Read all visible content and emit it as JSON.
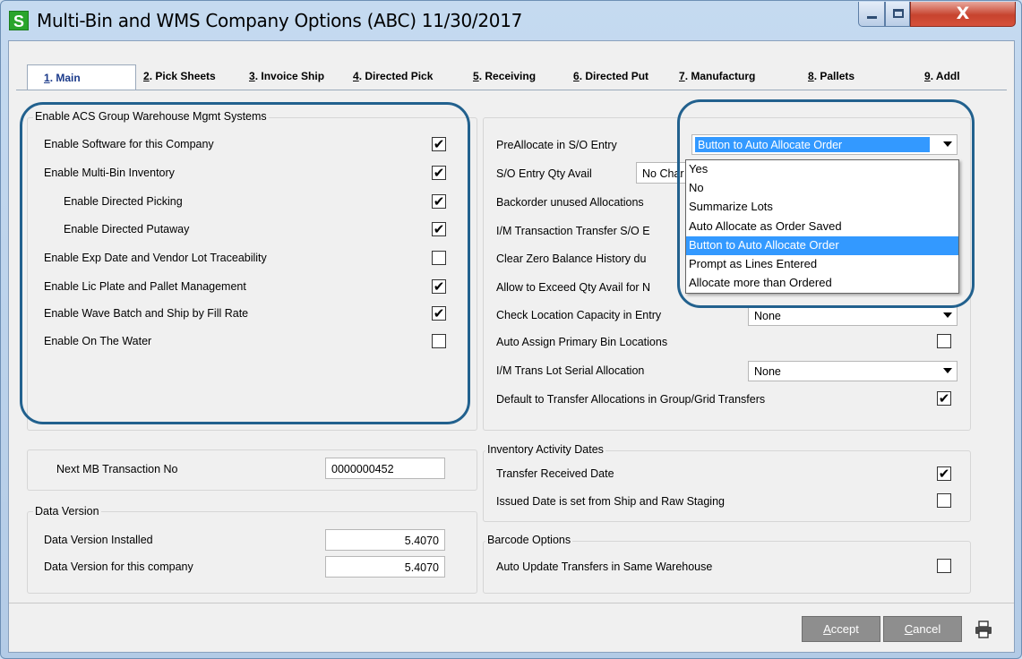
{
  "window": {
    "app_icon_letter": "S",
    "title": "Multi-Bin and WMS Company Options (ABC) 11/30/2017",
    "close_glyph": "X"
  },
  "tabs": [
    {
      "num": "1",
      "label": ". Main"
    },
    {
      "num": "2",
      "label": ". Pick Sheets"
    },
    {
      "num": "3",
      "label": ". Invoice Ship"
    },
    {
      "num": "4",
      "label": ". Directed Pick"
    },
    {
      "num": "5",
      "label": ". Receiving"
    },
    {
      "num": "6",
      "label": ". Directed Put"
    },
    {
      "num": "7",
      "label": ". Manufacturg"
    },
    {
      "num": "8",
      "label": ". Pallets"
    },
    {
      "num": "9",
      "label": ". Addl"
    }
  ],
  "wms_group": {
    "title": "Enable ACS Group Warehouse Mgmt Systems",
    "items": [
      {
        "label": "Enable Software for this Company",
        "checked": true
      },
      {
        "label": "Enable Multi-Bin Inventory",
        "checked": true
      },
      {
        "label": "Enable Directed Picking",
        "checked": true
      },
      {
        "label": "Enable Directed Putaway",
        "checked": true
      },
      {
        "label": "Enable Exp Date and Vendor Lot Traceability",
        "checked": false
      },
      {
        "label": "Enable Lic Plate and Pallet Management",
        "checked": true
      },
      {
        "label": "Enable Wave Batch and Ship by Fill Rate",
        "checked": true
      },
      {
        "label": "Enable On The Water",
        "checked": false
      }
    ]
  },
  "next_mb": {
    "label": "Next MB Transaction No",
    "value": "0000000452"
  },
  "data_version": {
    "title": "Data Version",
    "installed_label": "Data Version Installed",
    "installed_value": "5.4070",
    "company_label": "Data Version for this company",
    "company_value": "5.4070"
  },
  "right_group": {
    "preallocate_label": "PreAllocate in S/O Entry",
    "preallocate_value": "Button to Auto Allocate Order",
    "qty_avail_label": "S/O Entry Qty Avail",
    "qty_avail_value": "No Char",
    "backorder_label": "Backorder unused Allocations",
    "im_transfer_label": "I/M Transaction Transfer S/O E",
    "clear_zero_label": "Clear Zero Balance History du",
    "allow_exceed_label": "Allow to Exceed Qty Avail for N",
    "check_capacity_label": "Check Location Capacity in Entry",
    "check_capacity_value": "None",
    "auto_assign_label": "Auto Assign Primary Bin Locations",
    "auto_assign_checked": false,
    "lot_serial_label": "I/M Trans Lot Serial Allocation",
    "lot_serial_value": "None",
    "default_transfer_label": "Default to Transfer Allocations in Group/Grid Transfers",
    "default_transfer_checked": true
  },
  "dropdown": {
    "options": [
      "Yes",
      "No",
      "Summarize Lots",
      "Auto Allocate as Order Saved",
      "Button to Auto Allocate Order",
      "Prompt as Lines Entered",
      "Allocate more than Ordered"
    ],
    "selected_index": 4
  },
  "inventory_dates": {
    "title": "Inventory Activity Dates",
    "transfer_received_label": "Transfer Received Date",
    "transfer_received_checked": true,
    "issued_date_label": "Issued Date is set from Ship and Raw Staging",
    "issued_date_checked": false
  },
  "barcode": {
    "title": "Barcode Options",
    "auto_update_label": "Auto Update Transfers in Same Warehouse",
    "auto_update_checked": false
  },
  "buttons": {
    "accept_key": "A",
    "accept_rest": "ccept",
    "cancel_key": "C",
    "cancel_rest": "ancel"
  },
  "colors": {
    "annotation": "#22618e",
    "selection": "#3399ff",
    "disabled_button": "#8e8e8e"
  }
}
